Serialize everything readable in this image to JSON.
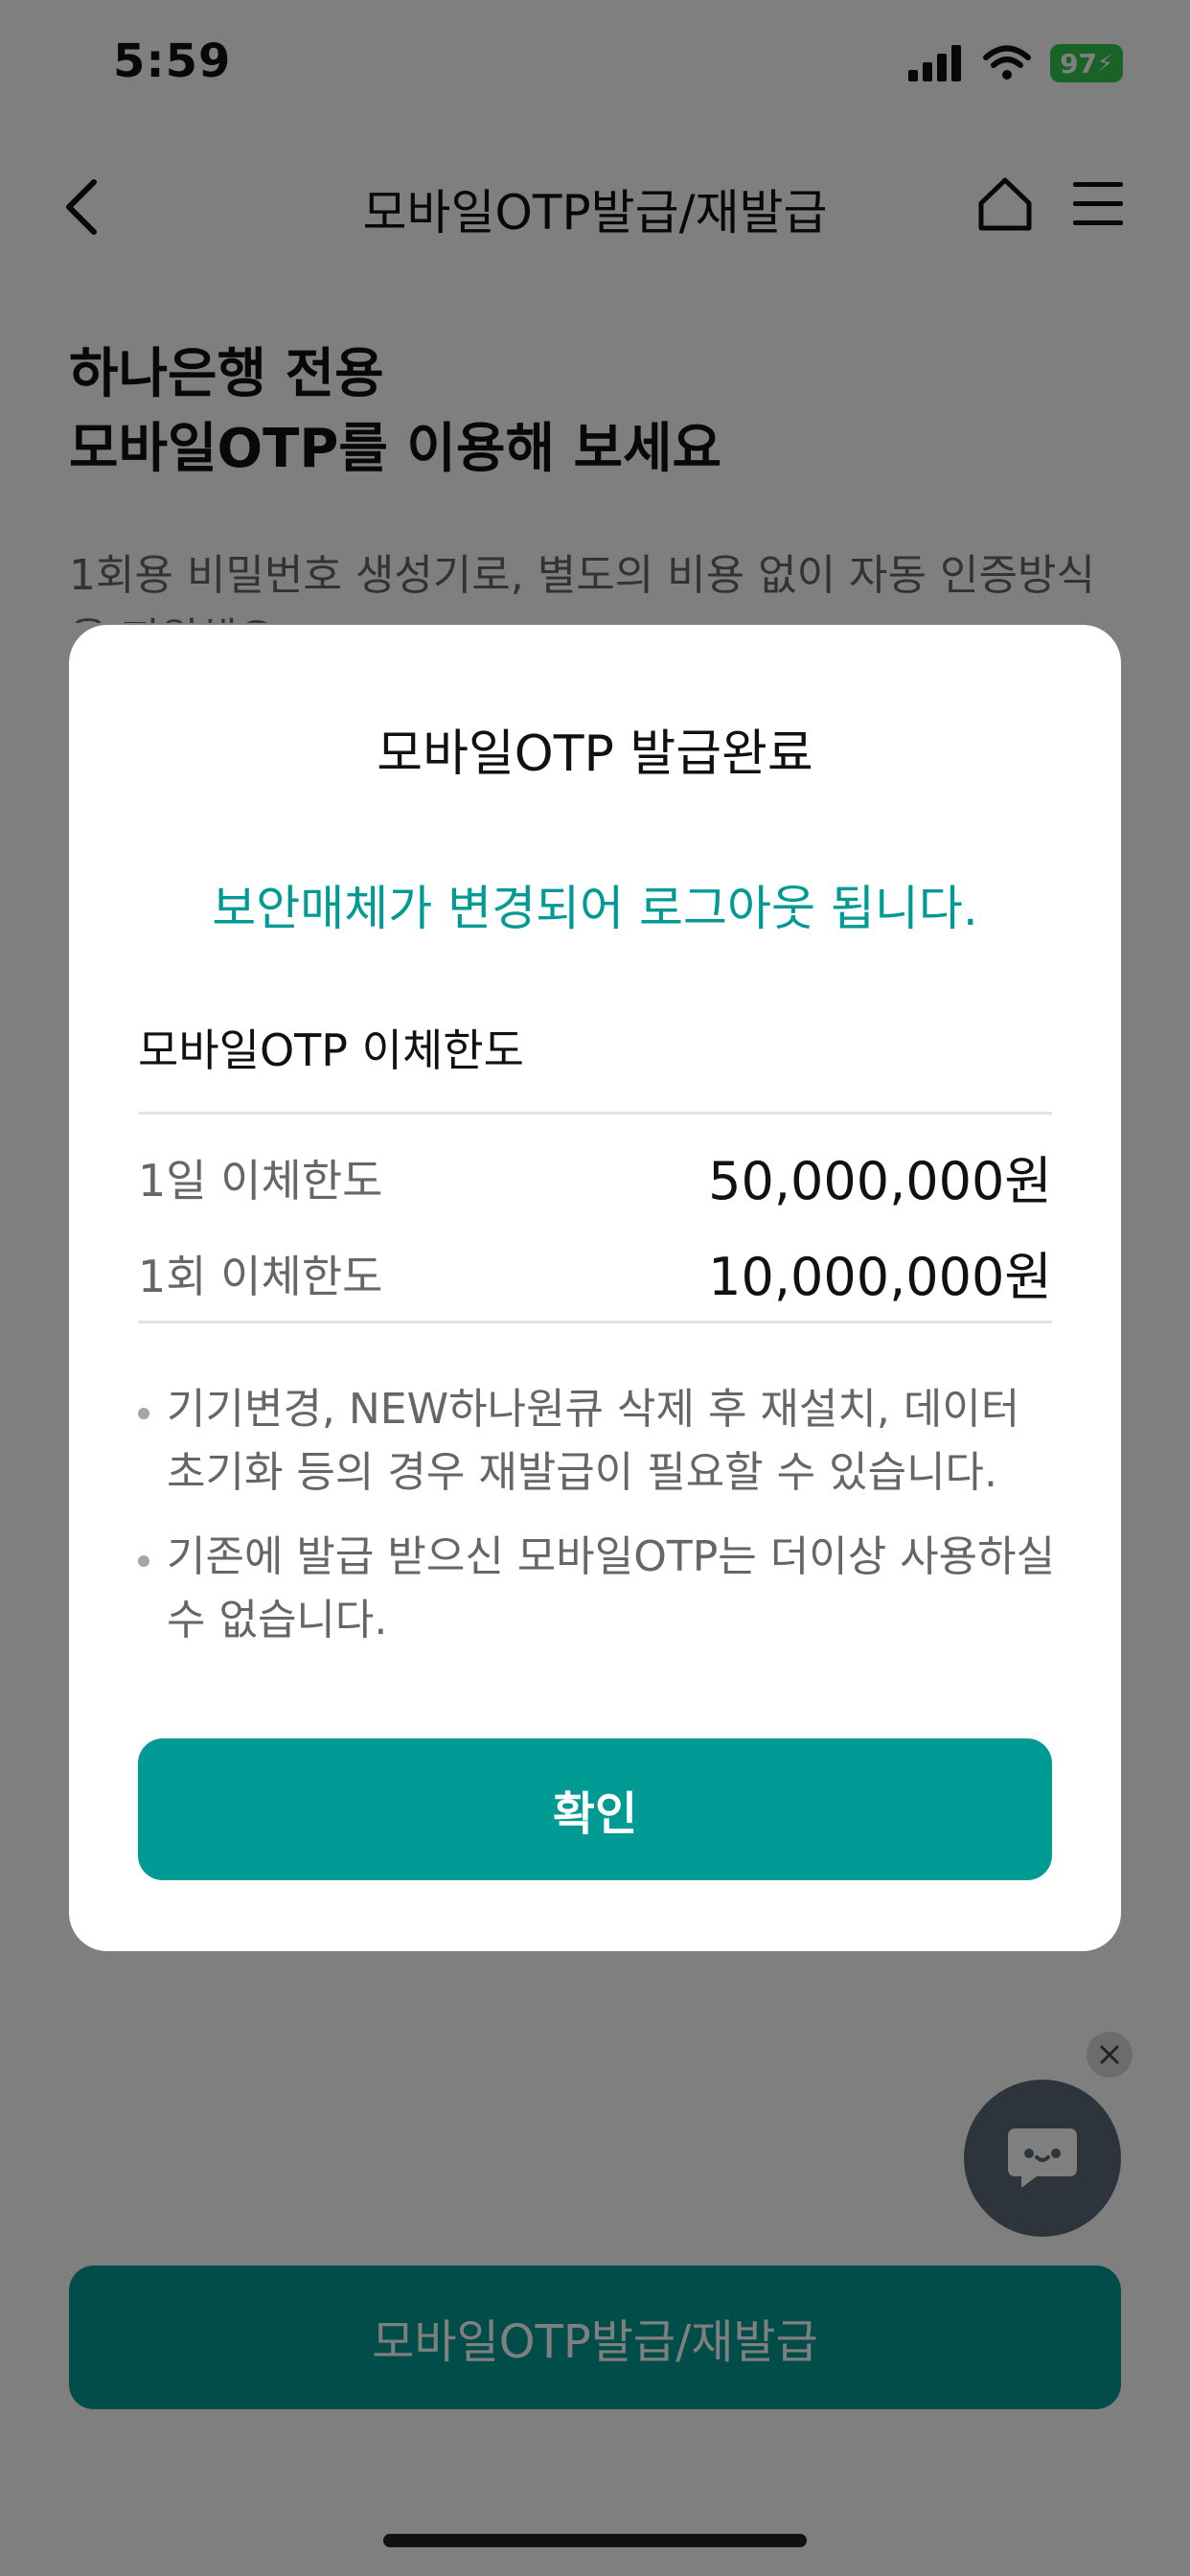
{
  "status_bar": {
    "time": "5:59",
    "battery": "97"
  },
  "header": {
    "title": "모바일OTP발급/재발급"
  },
  "page": {
    "hero_title_line1": "하나은행 전용",
    "hero_title_line2": "모바일OTP를 이용해 보세요",
    "description": "1회용 비밀번호 생성기로, 별도의 비용 없이 자동 인증방식을 지원해요",
    "bottom_button": "모바일OTP발급/재발급"
  },
  "modal": {
    "title": "모바일OTP 발급완료",
    "message": "보안매체가 변경되어 로그아웃 됩니다.",
    "limit_heading": "모바일OTP 이체한도",
    "limits": [
      {
        "label": "1일 이체한도",
        "value": "50,000,000원"
      },
      {
        "label": "1회 이체한도",
        "value": "10,000,000원"
      }
    ],
    "notes": [
      "기기변경, NEW하나원큐 삭제 후 재설치, 데이터 초기화 등의 경우 재발급이 필요할 수 있습니다.",
      "기존에 발급 받으신 모바일OTP는 더이상 사용하실 수 없습니다."
    ],
    "confirm": "확인"
  },
  "icons": {
    "back": "chevron-left-icon",
    "home": "home-icon",
    "menu": "hamburger-menu-icon",
    "chat": "chatbot-icon",
    "close": "close-icon"
  },
  "colors": {
    "accent": "#009a94",
    "overlay": "rgba(0,0,0,0.5)",
    "battery": "#31c64b"
  }
}
